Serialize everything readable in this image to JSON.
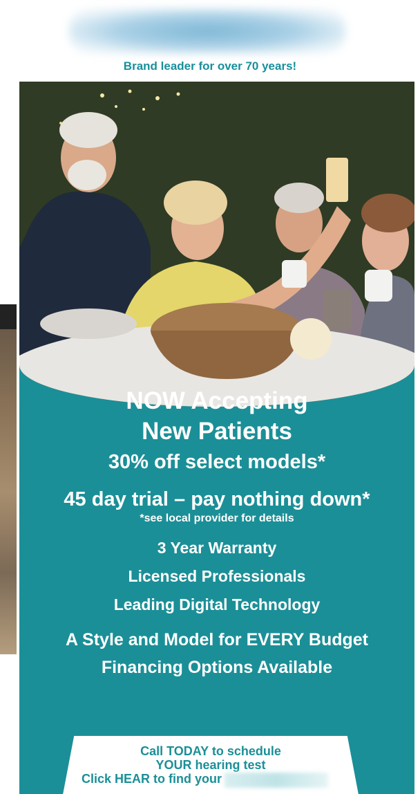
{
  "brand": {
    "logo_icon": "blurred-brand-logo",
    "tagline": "Brand leader for over 70 years!"
  },
  "colors": {
    "teal": "#1b8f97",
    "tagline_teal": "#178f9c"
  },
  "photo": {
    "icon": "group-of-seniors-photo"
  },
  "offers": {
    "headline_1": "NOW Accepting",
    "headline_2": "New Patients",
    "discount": "30% off select models*",
    "trial": "45 day trial – pay nothing down*",
    "disclaimer": "*see local provider for details",
    "benefits": [
      "3 Year Warranty",
      "Licensed Professionals",
      "Leading Digital Technology"
    ],
    "budget_1": "A Style and Model for EVERY Budget",
    "budget_2": "Financing Options Available"
  },
  "cta": {
    "line_1": "Call TODAY to schedule",
    "line_2": "YOUR hearing test",
    "line_3": "Click HEAR to find your"
  }
}
